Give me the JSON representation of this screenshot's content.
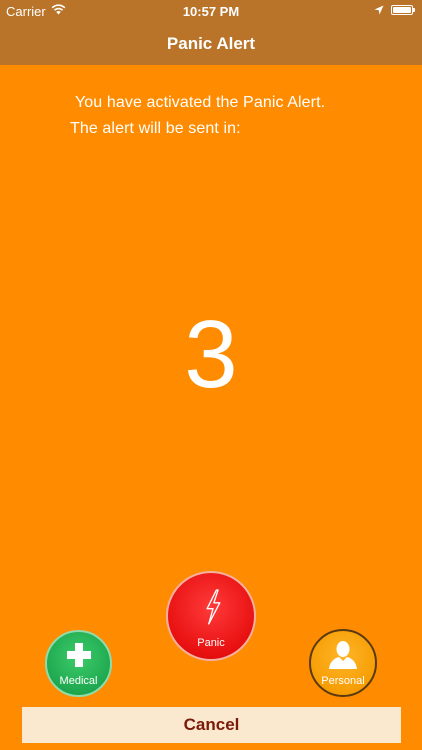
{
  "status_bar": {
    "carrier": "Carrier",
    "time": "10:57 PM",
    "icons": [
      "wifi-icon",
      "location-arrow-icon",
      "battery-icon"
    ]
  },
  "nav": {
    "title": "Panic Alert"
  },
  "message": {
    "line1": "You have activated the Panic Alert.",
    "line2": "The alert will be sent in:"
  },
  "countdown": {
    "value": "3"
  },
  "alerts": {
    "panic": {
      "label": "Panic",
      "icon": "lightning-bolt-icon",
      "color": "#e81010"
    },
    "medical": {
      "label": "Medical",
      "icon": "medical-cross-icon",
      "color": "#1ba34c"
    },
    "personal": {
      "label": "Personal",
      "icon": "person-silhouette-icon",
      "color": "#f59a00"
    }
  },
  "cancel": {
    "label": "Cancel"
  },
  "colors": {
    "background": "#ff8c00",
    "nav_bar": "#b9742a",
    "cancel_bg": "#fbe9cf",
    "cancel_text": "#7a1a0a"
  }
}
